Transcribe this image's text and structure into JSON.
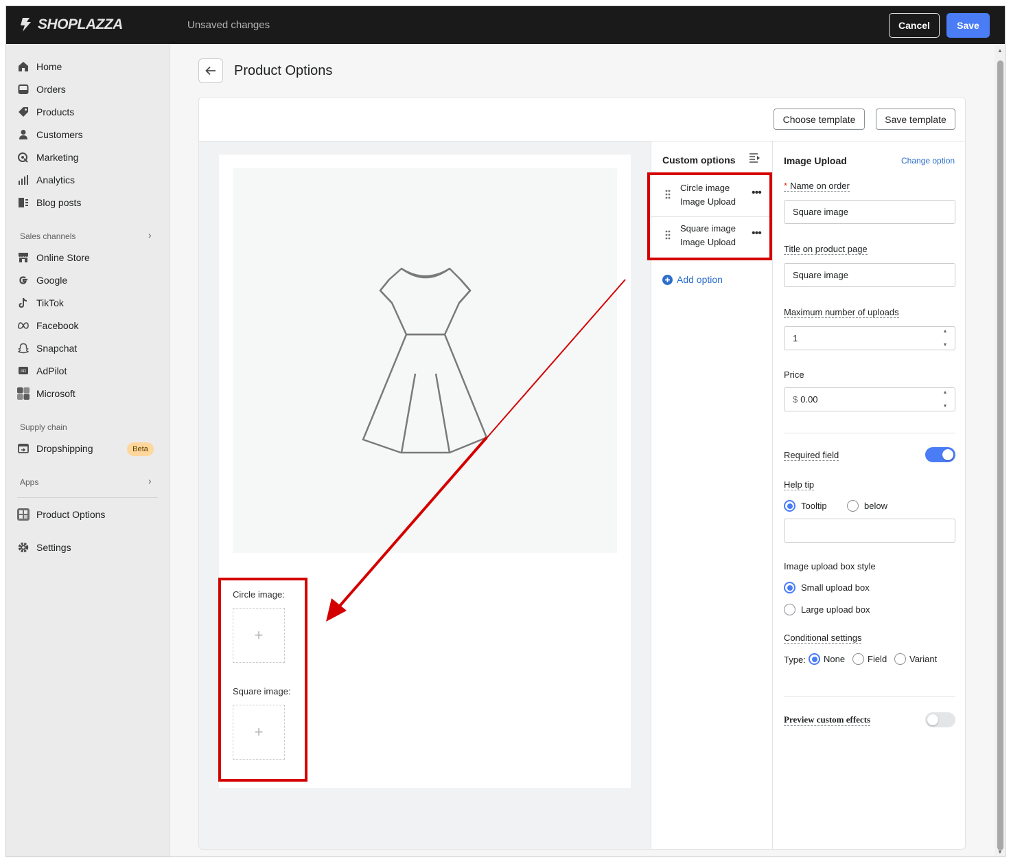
{
  "topbar": {
    "brand": "SHOPLAZZA",
    "status": "Unsaved changes",
    "cancel_label": "Cancel",
    "save_label": "Save"
  },
  "sidebar": {
    "items": [
      {
        "label": "Home",
        "icon": "home-icon"
      },
      {
        "label": "Orders",
        "icon": "orders-icon"
      },
      {
        "label": "Products",
        "icon": "tag-icon"
      },
      {
        "label": "Customers",
        "icon": "person-icon"
      },
      {
        "label": "Marketing",
        "icon": "target-icon"
      },
      {
        "label": "Analytics",
        "icon": "bar-chart-icon"
      },
      {
        "label": "Blog posts",
        "icon": "blog-icon"
      }
    ],
    "sales_channels_title": "Sales channels",
    "channels": [
      {
        "label": "Online Store",
        "icon": "store-icon"
      },
      {
        "label": "Google",
        "icon": "google-icon"
      },
      {
        "label": "TikTok",
        "icon": "tiktok-icon"
      },
      {
        "label": "Facebook",
        "icon": "meta-icon"
      },
      {
        "label": "Snapchat",
        "icon": "ghost-icon"
      },
      {
        "label": "AdPilot",
        "icon": "ad-icon"
      },
      {
        "label": "Microsoft",
        "icon": "microsoft-icon"
      }
    ],
    "supply_chain_title": "Supply chain",
    "dropshipping_label": "Dropshipping",
    "beta_badge": "Beta",
    "apps_title": "Apps",
    "product_options_label": "Product Options",
    "settings_label": "Settings"
  },
  "page": {
    "title": "Product Options",
    "choose_template": "Choose template",
    "save_template": "Save template"
  },
  "preview": {
    "circle_label": "Circle image:",
    "square_label": "Square image:",
    "plus": "+"
  },
  "options": {
    "title": "Custom options",
    "items": [
      {
        "name": "Circle image",
        "type": "Image Upload"
      },
      {
        "name": "Square image",
        "type": "Image Upload"
      }
    ],
    "more": "•••",
    "add_label": "Add option"
  },
  "settings": {
    "title": "Image Upload",
    "change_option": "Change option",
    "name_on_order_label": "Name on order",
    "name_on_order_value": "Square image",
    "title_on_page_label": "Title on product page",
    "title_on_page_value": "Square image",
    "max_uploads_label": "Maximum number of uploads",
    "max_uploads_value": "1",
    "price_label": "Price",
    "price_currency": "$",
    "price_value": "0.00",
    "required_label": "Required field",
    "required_on": true,
    "help_tip_label": "Help tip",
    "help_tip_options": [
      "Tooltip",
      "below"
    ],
    "help_tip_selected": "Tooltip",
    "help_tip_text": "",
    "box_style_label": "Image upload box style",
    "box_style_options": [
      "Small upload box",
      "Large upload box"
    ],
    "box_style_selected": "Small upload box",
    "conditional_label": "Conditional settings",
    "type_label": "Type:",
    "type_options": [
      "None",
      "Field",
      "Variant"
    ],
    "type_selected": "None",
    "preview_effects_label": "Preview custom effects",
    "preview_effects_on": false
  },
  "colors": {
    "accent": "#4a7cf6",
    "link": "#2c6ecb",
    "highlight": "#d40000",
    "topbar": "#1a1a1a"
  }
}
